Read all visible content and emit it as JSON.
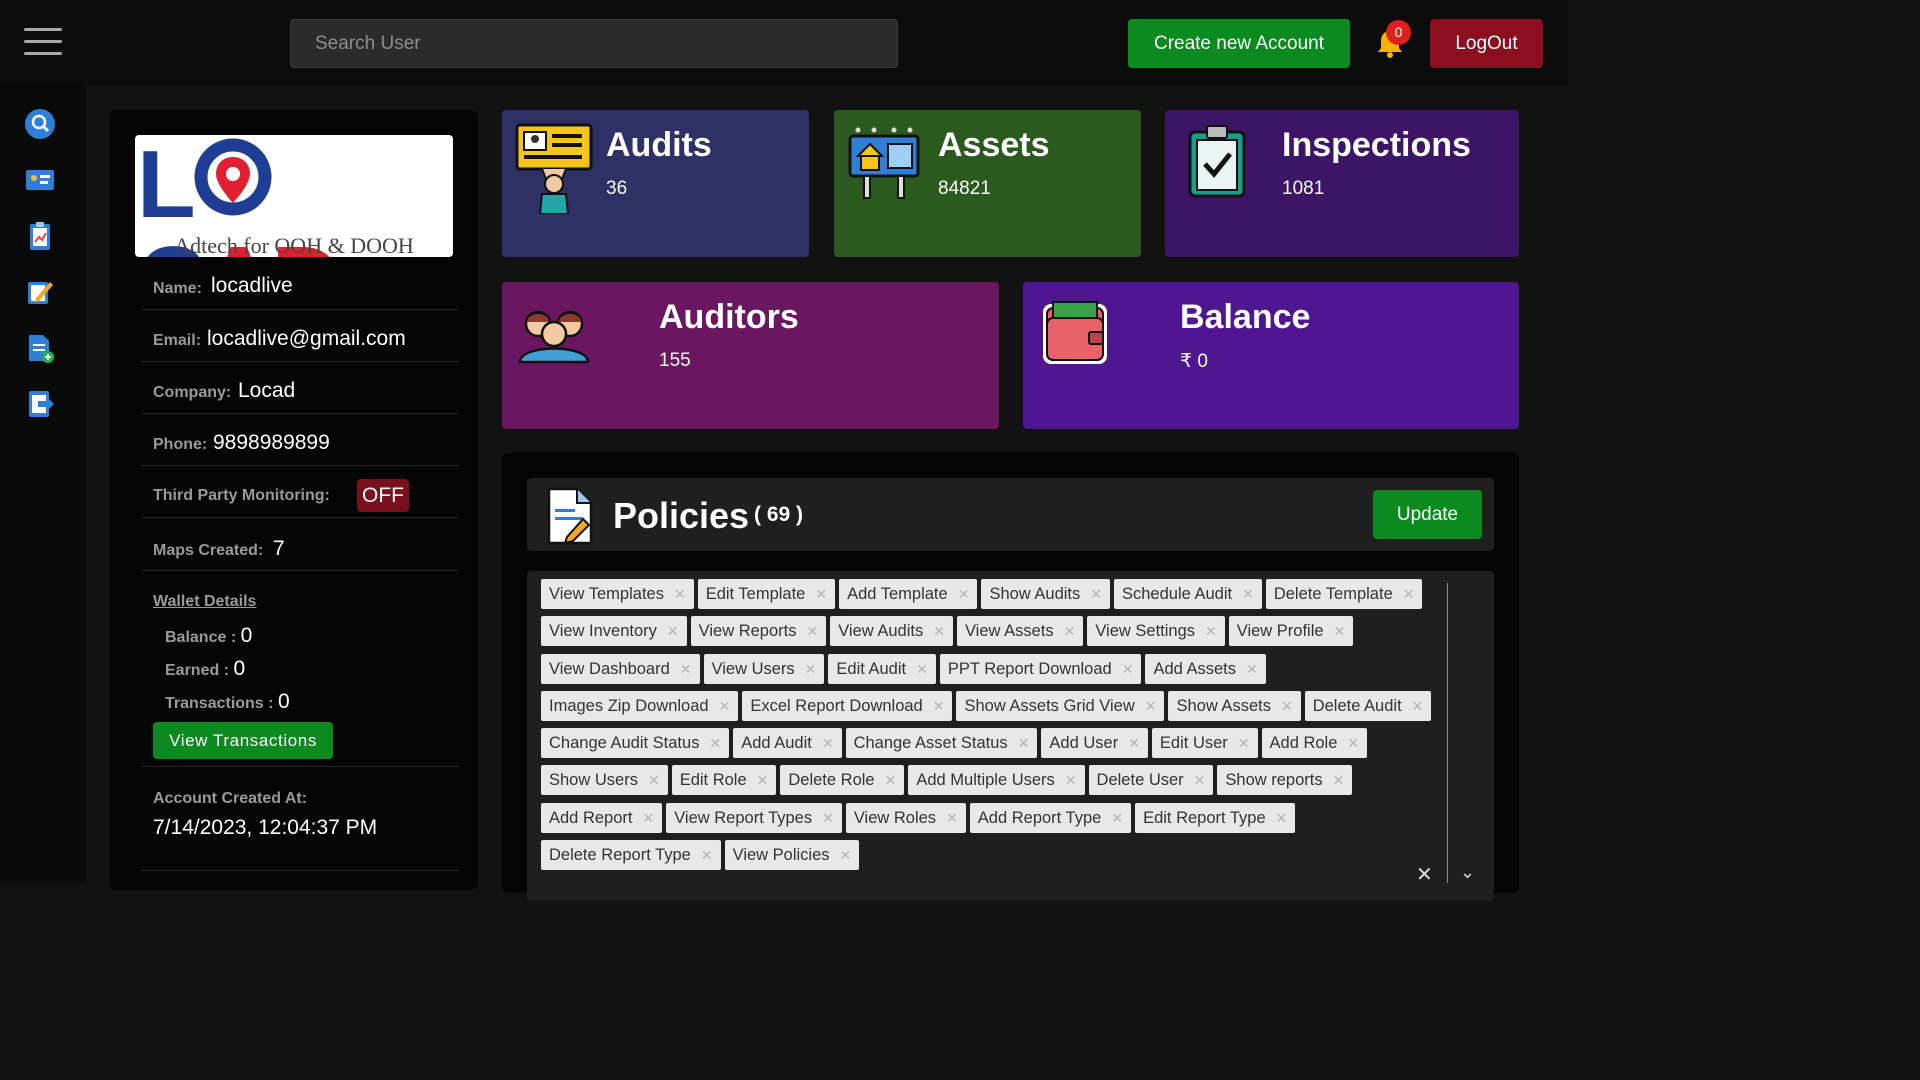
{
  "header": {
    "search_placeholder": "Search User",
    "create_label": "Create new Account",
    "notification_count": "0",
    "logout_label": "LogOut"
  },
  "sidebar": {
    "icons": [
      "search-icon",
      "dashboard-card-icon",
      "clipboard-chart-icon",
      "edit-pencil-icon",
      "add-document-icon",
      "exit-icon"
    ]
  },
  "profile": {
    "logo": {
      "main": "LOCAD",
      "tagline": "Adtech for OOH & DOOH"
    },
    "name_label": "Name:",
    "name": "locadlive",
    "email_label": "Email:",
    "email": "locadlive@gmail.com",
    "company_label": "Company:",
    "company": "Locad",
    "phone_label": "Phone:",
    "phone": "9898989899",
    "tpm_label": "Third Party Monitoring:",
    "tpm_status": "OFF",
    "maps_label": "Maps Created:",
    "maps": "7",
    "wallet_title": "Wallet Details",
    "balance_label": "Balance :",
    "balance": "0",
    "earned_label": "Earned :",
    "earned": "0",
    "transactions_label": "Transactions :",
    "transactions": "0",
    "view_transactions": "View Transactions",
    "created_label": "Account Created At:",
    "created_at": "7/14/2023, 12:04:37 PM"
  },
  "stats": {
    "audits": {
      "title": "Audits",
      "value": "36",
      "color": "#2f3066"
    },
    "assets": {
      "title": "Assets",
      "value": "84821",
      "color": "#2a5a1e"
    },
    "inspections": {
      "title": "Inspections",
      "value": "1081",
      "color": "#3c1566"
    },
    "auditors": {
      "title": "Auditors",
      "value": "155",
      "color": "#6b1660"
    },
    "balance": {
      "title": "Balance",
      "value": "₹ 0",
      "color": "#4e1690"
    }
  },
  "policies": {
    "title": "Policies",
    "count": "( 69 )",
    "update_label": "Update",
    "tags": [
      "View Templates",
      "Edit Template",
      "Add Template",
      "Show Audits",
      "Schedule Audit",
      "Delete Template",
      "View Inventory",
      "View Reports",
      "View Audits",
      "View Assets",
      "View Settings",
      "View Profile",
      "View Dashboard",
      "View Users",
      "Edit Audit",
      "PPT Report Download",
      "Add Assets",
      "Images Zip Download",
      "Excel Report Download",
      "Show Assets Grid View",
      "Show Assets",
      "Delete Audit",
      "Change Audit Status",
      "Add Audit",
      "Change Asset Status",
      "Add User",
      "Edit User",
      "Add Role",
      "Show Users",
      "Edit Role",
      "Delete Role",
      "Add Multiple Users",
      "Delete User",
      "Show reports",
      "Add Report",
      "View Report Types",
      "View Roles",
      "Add Report Type",
      "Edit Report Type",
      "Delete Report Type",
      "View Policies"
    ]
  }
}
